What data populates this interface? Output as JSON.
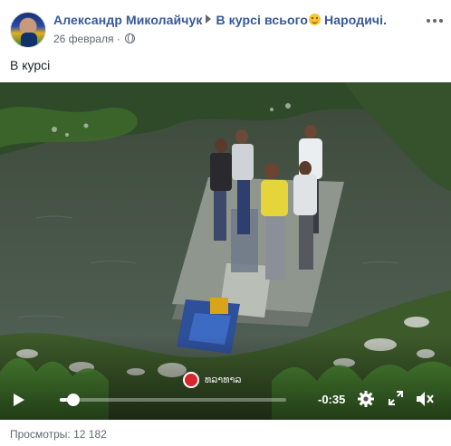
{
  "post": {
    "author": "Александр Миколайчук",
    "group": "В курсі всього",
    "group_suffix": " Народичі.",
    "date": "26 февраля",
    "separator": "·",
    "text": "В курсі"
  },
  "video": {
    "time_remaining": "-0:35",
    "progress": 0.06,
    "watermark": "ທລາທາລ",
    "colors": {
      "water": "#4a5a48",
      "vegetation": "#3e6a2a",
      "boat": "#9aa29a",
      "shirt": "#e6d53a"
    }
  },
  "footer": {
    "views_label": "Просмотры: 12 182"
  },
  "icons": {
    "globe": "globe-icon",
    "more": "more-icon",
    "play": "play-icon",
    "settings": "gear-icon",
    "fullscreen": "fullscreen-icon",
    "volume": "volume-muted-icon"
  }
}
